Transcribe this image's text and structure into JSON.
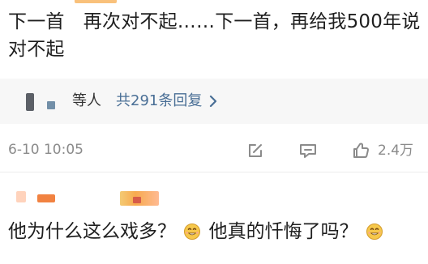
{
  "comment": {
    "text": "下一首　再次对不起……下一首，再给我500年说对不起"
  },
  "reply_preview": {
    "who_label": "等人",
    "count_link": "共291条回复",
    "chevron_icon": "chevron-right-icon"
  },
  "meta": {
    "timestamp": "6-10 10:05",
    "edit_icon": "edit-icon",
    "comment_icon": "comment-icon",
    "like_icon": "thumbs-up-icon",
    "like_count": "2.4万"
  },
  "next_comment": {
    "text_part1": "他为什么这么戏多？",
    "emoji1": "smile-emoji-icon",
    "text_part2": "他真的忏悔了吗？",
    "emoji2": "smile-emoji-icon"
  },
  "colors": {
    "link_blue": "#4a6f96",
    "meta_gray": "#8b8b8b",
    "reply_bg": "#f7f7f7"
  }
}
